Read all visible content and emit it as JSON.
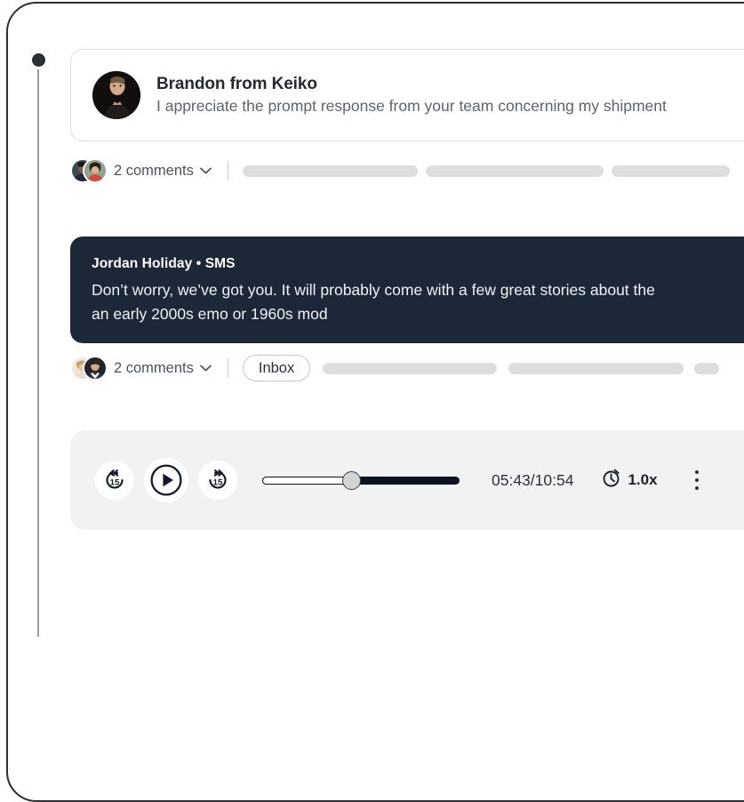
{
  "thread": {
    "message_card": {
      "author": "Brandon from Keiko",
      "preview": "I appreciate the prompt response from your team concerning my shipment",
      "avatar": "avatar-photo-brandon"
    },
    "meta_row_1": {
      "comments_label": "2 comments",
      "chevron": "chevron-down-icon",
      "skeleton_widths": [
        197,
        200,
        133
      ]
    },
    "dark_card": {
      "author_line": "Jordan Holiday • SMS",
      "line_1": "Don’t worry, we’ve got you. It will probably come with a few great stories about the",
      "line_2": "an early 2000s emo or 1960s mod",
      "background": "#1c2838"
    },
    "meta_row_2": {
      "comments_label": "2 comments",
      "chevron": "chevron-down-icon",
      "tag_label": "Inbox",
      "skeleton_widths": [
        196,
        197,
        28
      ]
    }
  },
  "player": {
    "rewind_label": "15",
    "rewind_icon": "rewind-15-icon",
    "play_icon": "play-icon",
    "forward_label": "15",
    "forward_icon": "forward-15-icon",
    "progress_percent": 45,
    "time_display": "05:43/10:54",
    "elapsed": "05:43",
    "duration": "10:54",
    "speed_icon": "stopwatch-icon",
    "speed_label": "1.0x",
    "menu_icon": "kebab-menu-icon"
  },
  "colors": {
    "dark_card": "#1c2838",
    "player_bg": "#f2f2f2",
    "skeleton": "#dedede",
    "accent_dark": "#0b1220"
  }
}
